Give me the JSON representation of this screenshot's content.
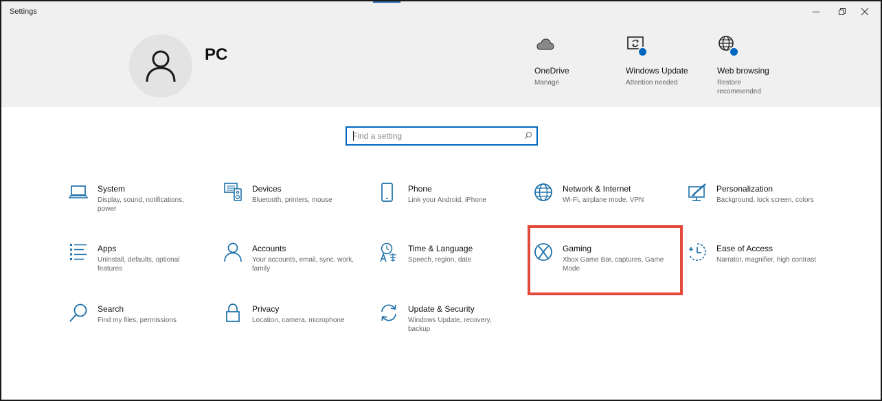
{
  "window": {
    "title": "Settings"
  },
  "user": {
    "name": "PC"
  },
  "header_items": [
    {
      "label": "OneDrive",
      "sub": "Manage"
    },
    {
      "label": "Windows Update",
      "sub": "Attention needed"
    },
    {
      "label": "Web browsing",
      "sub": "Restore recommended"
    }
  ],
  "search": {
    "placeholder": "Find a setting"
  },
  "categories": [
    {
      "title": "System",
      "desc": "Display, sound, notifications, power",
      "icon": "laptop-icon"
    },
    {
      "title": "Devices",
      "desc": "Bluetooth, printers, mouse",
      "icon": "devices-icon"
    },
    {
      "title": "Phone",
      "desc": "Link your Android, iPhone",
      "icon": "phone-icon"
    },
    {
      "title": "Network & Internet",
      "desc": "Wi-Fi, airplane mode, VPN",
      "icon": "globe-icon"
    },
    {
      "title": "Personalization",
      "desc": "Background, lock screen, colors",
      "icon": "paint-icon"
    },
    {
      "title": "Apps",
      "desc": "Uninstall, defaults, optional features",
      "icon": "apps-list-icon"
    },
    {
      "title": "Accounts",
      "desc": "Your accounts, email, sync, work, family",
      "icon": "person-icon"
    },
    {
      "title": "Time & Language",
      "desc": "Speech, region, date",
      "icon": "time-language-icon"
    },
    {
      "title": "Gaming",
      "desc": "Xbox Game Bar, captures, Game Mode",
      "icon": "xbox-icon"
    },
    {
      "title": "Ease of Access",
      "desc": "Narrator, magnifier, high contrast",
      "icon": "ease-of-access-icon"
    },
    {
      "title": "Search",
      "desc": "Find my files, permissions",
      "icon": "search-icon"
    },
    {
      "title": "Privacy",
      "desc": "Location, camera, microphone",
      "icon": "lock-icon"
    },
    {
      "title": "Update & Security",
      "desc": "Windows Update, recovery, backup",
      "icon": "sync-arrows-icon"
    }
  ],
  "colors": {
    "accent": "#0067c0",
    "highlight": "#e34a3a",
    "header_bg": "#f0f0f0",
    "icon": "#1a6fa8"
  }
}
